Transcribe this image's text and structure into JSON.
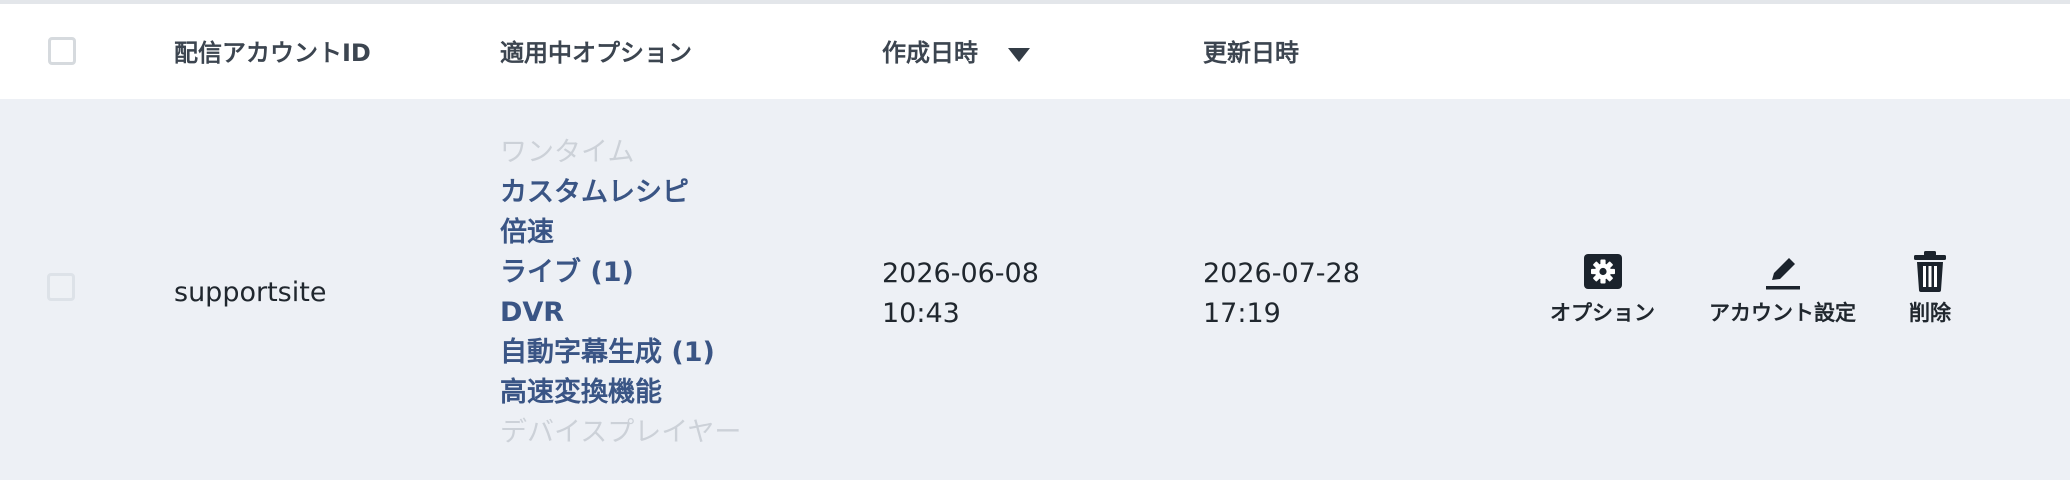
{
  "header": {
    "col_account_id": "配信アカウントID",
    "col_options": "適用中オプション",
    "col_created": "作成日時",
    "col_updated": "更新日時"
  },
  "row": {
    "account_id": "supportsite",
    "options": [
      {
        "label": "ワンタイム",
        "active": false
      },
      {
        "label": "カスタムレシピ",
        "active": true
      },
      {
        "label": "倍速",
        "active": true
      },
      {
        "label": "ライブ (1)",
        "active": true
      },
      {
        "label": "DVR",
        "active": true
      },
      {
        "label": "自動字幕生成 (1)",
        "active": true
      },
      {
        "label": "高速変換機能",
        "active": true
      },
      {
        "label": "デバイスプレイヤー",
        "active": false
      }
    ],
    "created_date": "2026-06-08",
    "created_time": "10:43",
    "updated_date": "2026-07-28",
    "updated_time": "17:19",
    "actions": {
      "options_label": "オプション",
      "account_settings_label": "アカウント設定",
      "delete_label": "削除"
    }
  },
  "icons": {
    "sort": "sort-desc-icon",
    "options": "gear-icon",
    "account_settings": "pencil-icon",
    "delete": "trash-icon"
  },
  "colors": {
    "active_option": "#3a5585",
    "inactive_option": "#ccd1d8",
    "row_background": "#edf0f5"
  }
}
